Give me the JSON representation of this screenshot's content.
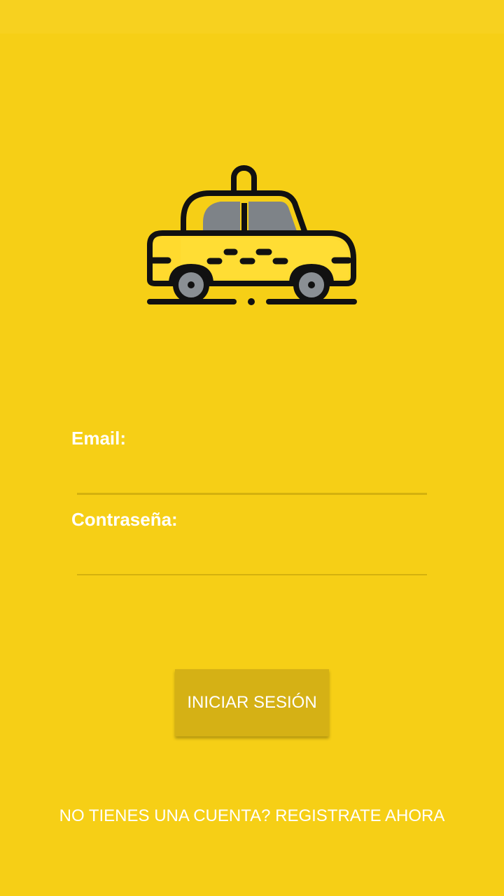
{
  "colors": {
    "background": "#F6CF16",
    "button": "#D5B115",
    "underline": "#D4B10E",
    "text": "#FFFFFF"
  },
  "logo": {
    "icon": "taxi-car-icon"
  },
  "form": {
    "email_label": "Email:",
    "email_value": "",
    "password_label": "Contraseña:",
    "password_value": ""
  },
  "login_button": {
    "label": "INICIAR SESIÓN"
  },
  "register_link": {
    "label": "NO TIENES UNA CUENTA? REGISTRATE AHORA"
  }
}
